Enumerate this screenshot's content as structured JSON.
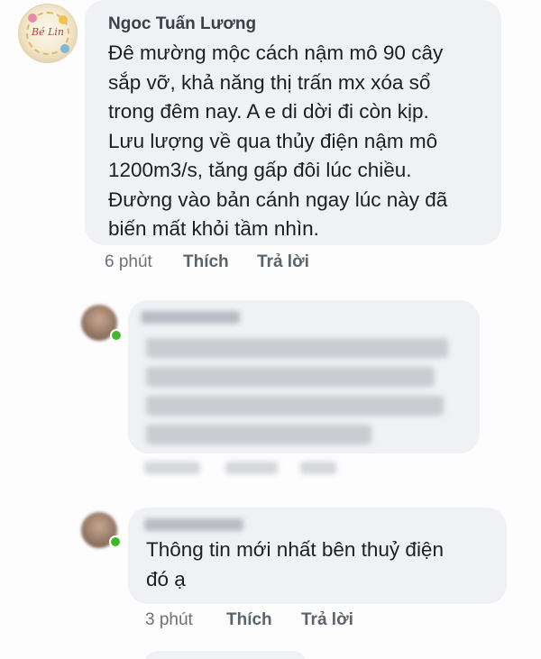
{
  "comment_1": {
    "author": "Ngoc Tuấn Lương",
    "text": "Đê mường mộc cách nậm mô 90 cây\nsắp vỡ, khả năng thị trấn mx xóa sổ\ntrong đêm nay. A e di dời đi còn kịp.\nLưu lượng về qua thủy điện nậm mô\n1200m3/s, tăng gấp đôi lúc chiều.\nĐường vào bản cánh ngay lúc này đã\nbiến mất khỏi tầm nhìn.",
    "time": "6 phút",
    "like_label": "Thích",
    "reply_label": "Trả lời",
    "avatar_logo_text": "Bé Lin",
    "avatar_icon": "profile-logo-avatar"
  },
  "comment_2": {
    "blurred": true,
    "avatar_icon": "blurred-profile-avatar",
    "online_color": "#42b72a"
  },
  "comment_3": {
    "text": "Thông tin mới nhất bên thuỷ điện\nđó ạ",
    "time": "3 phút",
    "like_label": "Thích",
    "reply_label": "Trả lời",
    "avatar_icon": "blurred-profile-avatar",
    "online_color": "#42b72a"
  },
  "colors": {
    "bubble_background": "#eff1f4",
    "text": "#1c1e21",
    "meta_text": "#6a717a"
  }
}
